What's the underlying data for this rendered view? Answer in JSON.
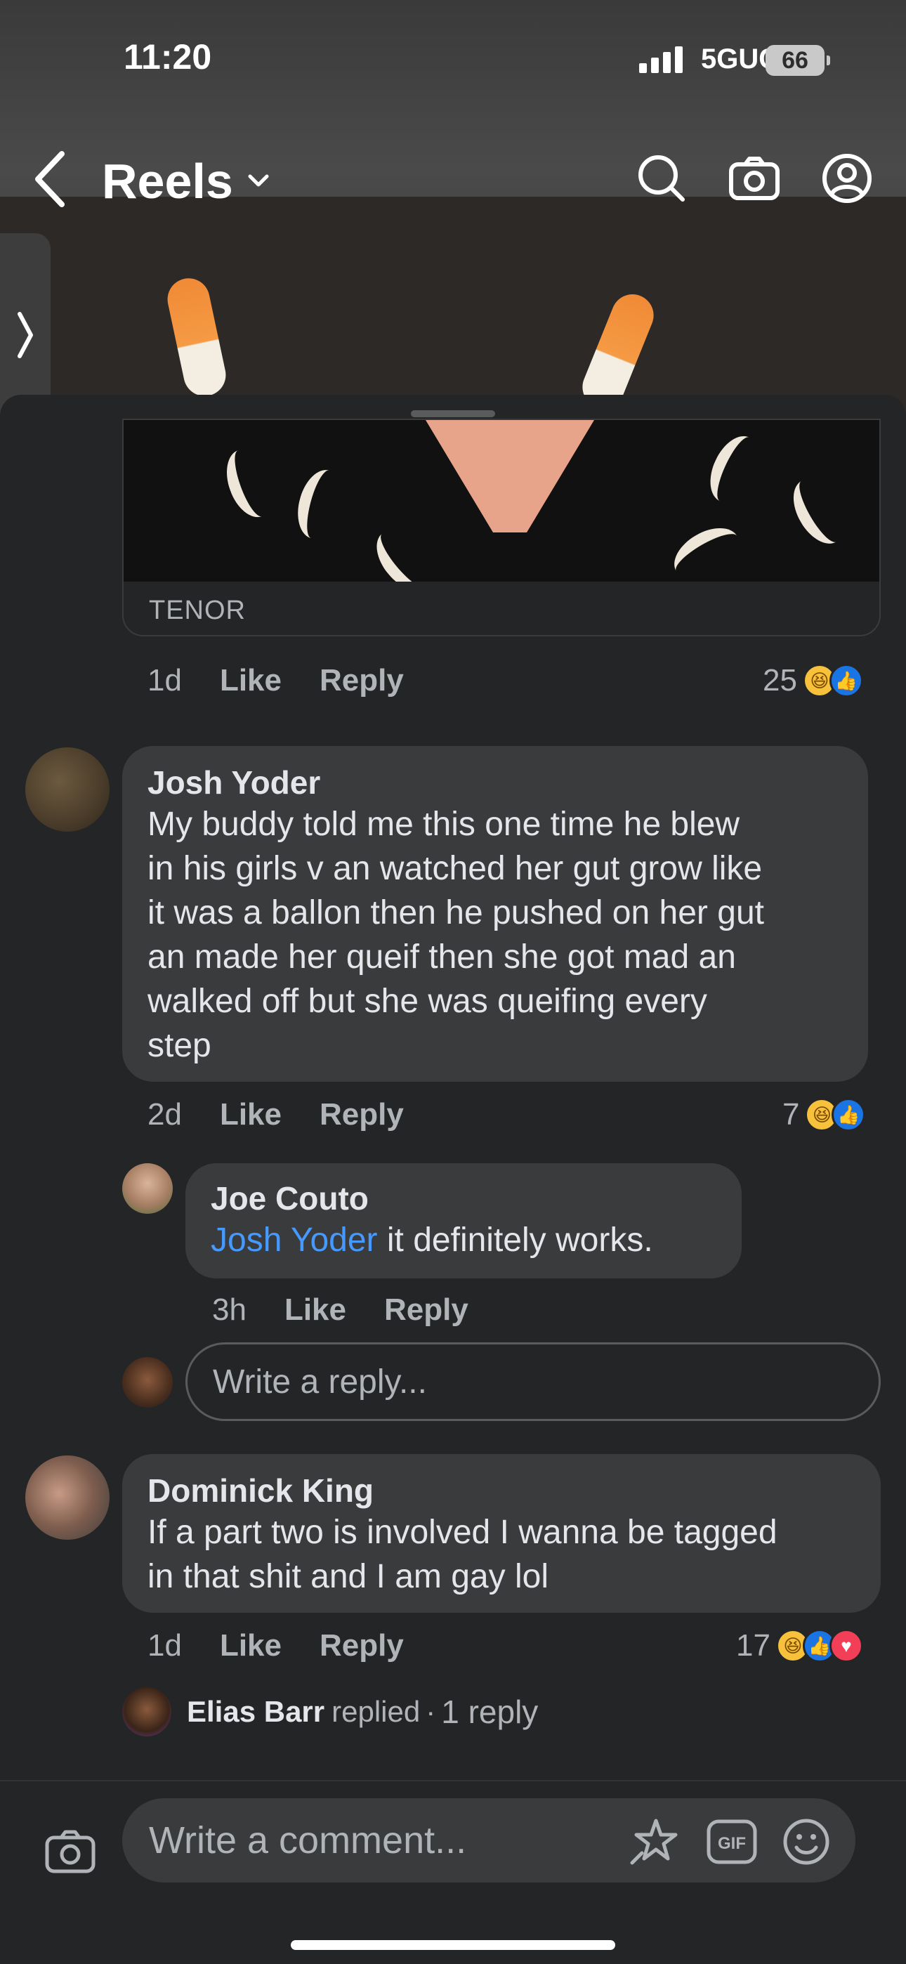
{
  "status_bar": {
    "time": "11:20",
    "network": "5GUC",
    "battery": "66"
  },
  "header": {
    "title": "Reels"
  },
  "gif_comment": {
    "source": "TENOR",
    "time": "1d",
    "like": "Like",
    "reply": "Reply",
    "reaction_count": "25",
    "reactions": [
      "haha",
      "like"
    ]
  },
  "comments": [
    {
      "author": "Josh Yoder",
      "lines": [
        "My buddy told me this one time he blew",
        "in his girls v an watched her gut grow like",
        "it was a ballon then he pushed on her gut",
        "an made her queif then she got mad an",
        "walked off but she was queifing every",
        "step"
      ],
      "time": "2d",
      "like": "Like",
      "reply": "Reply",
      "reaction_count": "7",
      "reactions": [
        "haha",
        "like"
      ]
    },
    {
      "author": "Joe Couto",
      "mention": "Josh Yoder",
      "text": " it definitely works.",
      "time": "3h",
      "like": "Like",
      "reply": "Reply"
    },
    {
      "author": "Dominick King",
      "lines": [
        "If a part two is involved I wanna be tagged",
        "in that shit and I am gay lol"
      ],
      "time": "1d",
      "like": "Like",
      "reply": "Reply",
      "reaction_count": "17",
      "reactions": [
        "haha",
        "like",
        "love"
      ]
    }
  ],
  "reply_input": {
    "placeholder": "Write a reply..."
  },
  "replied_summary": {
    "name": "Elias Barr",
    "verb": "replied",
    "separator": "·",
    "count": "1 reply"
  },
  "composer": {
    "placeholder": "Write a comment..."
  },
  "icons": {
    "back": "chevron-left-icon",
    "dropdown": "chevron-down-icon",
    "search": "search-icon",
    "camera": "camera-icon",
    "profile": "profile-icon",
    "side": "chevron-right-icon",
    "sticker": "sticker-icon",
    "gif": "gif-icon",
    "emoji": "emoji-icon"
  },
  "colors": {
    "background": "#242526",
    "bubble": "#3a3b3c",
    "mention": "#4599ff",
    "like": "#1b74e4",
    "haha": "#f7c13c",
    "love": "#f33e58"
  }
}
